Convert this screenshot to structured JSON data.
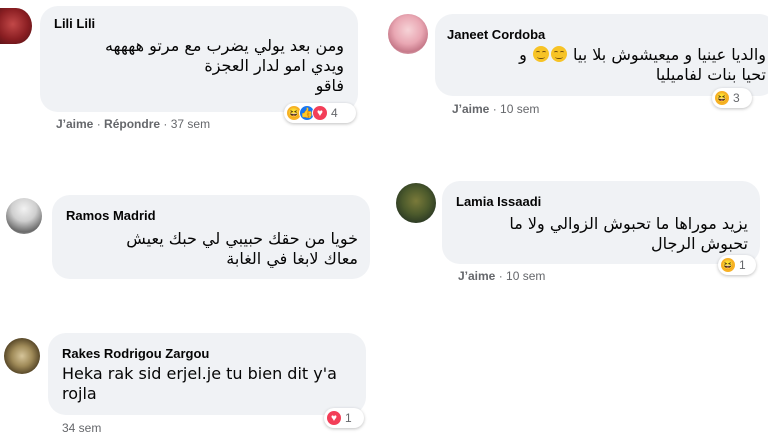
{
  "comments": [
    {
      "author": "Lili Lili",
      "text_lines": [
        "ومن بعد يولي يضرب مع مرتو ههههه",
        "ويدي امو لدار العجزة",
        "فاقو"
      ],
      "actions": {
        "like": "J’aime",
        "sep1": "·",
        "reply": "Répondre",
        "sep2": "·",
        "time": "37 sem"
      },
      "reactions": {
        "icons": [
          "haha-icon",
          "like-icon",
          "love-icon"
        ],
        "count": "4"
      }
    },
    {
      "author": "Janeet Cordoba",
      "text_lines": [
        "والديا عينيا و ميعيشوش بلا بيا",
        "و",
        "تحيا بنات لفاميليا"
      ],
      "actions": {
        "like": "J’aime",
        "sep1": "·",
        "time": "10 sem"
      },
      "reactions": {
        "icons": [
          "haha-icon"
        ],
        "count": "3"
      }
    },
    {
      "author": "Ramos Madrid",
      "text_lines": [
        "خويا من حقك حبيبي لي حبك يعيش",
        "معاك لابغا في الغابة"
      ],
      "actions": {}
    },
    {
      "author": "Lamia Issaadi",
      "text_lines": [
        "يزيد موراها ما تحبوش الزوالي ولا ما",
        "تحبوش الرجال"
      ],
      "actions": {
        "like": "J’aime",
        "sep1": "·",
        "time": "10 sem"
      },
      "reactions": {
        "icons": [
          "haha-icon"
        ],
        "count": "1"
      }
    },
    {
      "author": "Rakes Rodrigou Zargou",
      "text_lines": [
        "Heka rak sid erjel.je tu bien dit y'a",
        "rojla"
      ],
      "actions": {
        "time": "34 sem"
      },
      "reactions": {
        "icons": [
          "love-icon"
        ],
        "count": "1"
      }
    }
  ],
  "colors": {
    "bubble": "#f0f2f5",
    "meta": "#65676b",
    "like": "#1877f2",
    "love": "#f33e58",
    "haha": "#f7b125"
  }
}
